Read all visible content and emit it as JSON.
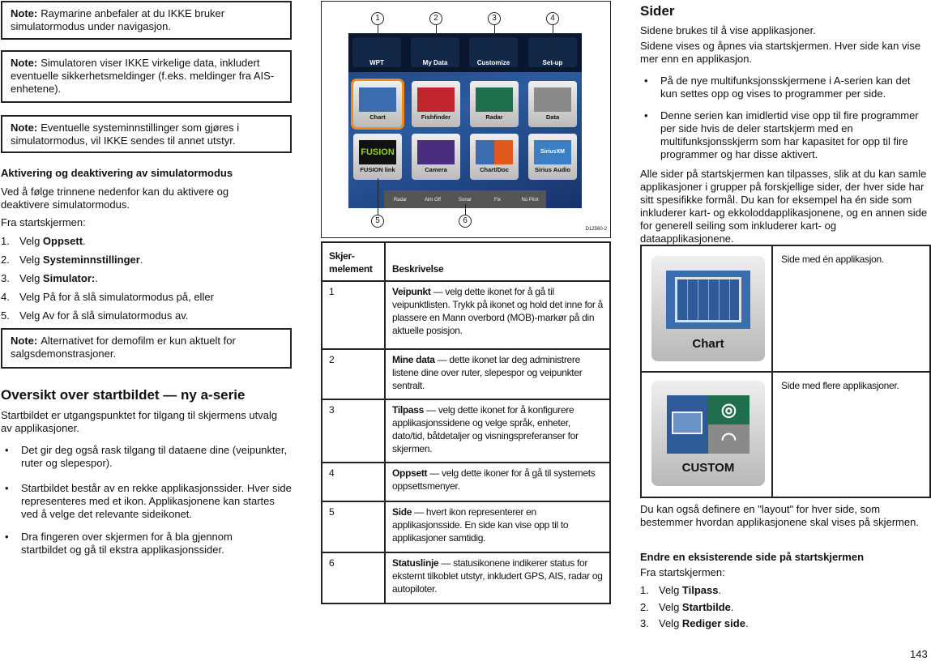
{
  "left": {
    "notes": [
      {
        "label": "Note:",
        "text": "Raymarine anbefaler at du IKKE bruker simulatormodus under navigasjon."
      },
      {
        "label": "Note:",
        "text": "Simulatoren viser IKKE virkelige data, inkludert eventuelle sikkerhetsmeldinger (f.eks. meldinger fra AIS-enhetene)."
      },
      {
        "label": "Note:",
        "text": "Eventuelle systeminnstillinger som gjøres i simulatormodus, vil IKKE sendes til annet utstyr."
      },
      {
        "label": "Note:",
        "text": "Alternativet for demofilm er kun aktuelt for salgsdemonstrasjoner."
      }
    ],
    "heading1": "Aktivering og deaktivering av simulatormodus",
    "para1": "Ved å følge trinnene nedenfor kan du aktivere og deaktivere simulatormodus.",
    "from_home": "Fra startskjermen:",
    "steps": [
      {
        "n": "1.",
        "pre": "Velg ",
        "bold": "Oppsett",
        "post": "."
      },
      {
        "n": "2.",
        "pre": "Velg ",
        "bold": "Systeminnstillinger",
        "post": "."
      },
      {
        "n": "3.",
        "pre": "Velg ",
        "bold": "Simulator:",
        "post": "."
      },
      {
        "n": "4.",
        "pre": "Velg På for å slå simulatormodus på, eller",
        "bold": "",
        "post": ""
      },
      {
        "n": "5.",
        "pre": "Velg Av for å slå simulatormodus av.",
        "bold": "",
        "post": ""
      }
    ],
    "heading2": "Oversikt over startbildet — ny a-serie",
    "para2": "Startbildet er utgangspunktet for tilgang til skjermens utvalg av applikasjoner.",
    "bullets": [
      "Det gir deg også rask tilgang til dataene dine (veipunkter, ruter og slepespor).",
      "Startbildet består av en rekke applikasjonssider. Hver side representeres med et ikon. Applikasjonene kan startes ved å velge det relevante sideikonet.",
      "Dra fingeren over skjermen for å bla gjennom startbildet og gå til ekstra applikasjonssider."
    ]
  },
  "figure": {
    "callouts": [
      "1",
      "2",
      "3",
      "4",
      "5",
      "6"
    ],
    "top_buttons": [
      "WPT",
      "My Data",
      "Customize",
      "Set-up"
    ],
    "tiles": [
      "Chart",
      "Fishfinder",
      "Radar",
      "Data",
      "FUSION link",
      "Camera",
      "Chart/Doc",
      "Sirius Audio"
    ],
    "fusion_logo": "FUSION",
    "sirius_logo": "SiriusXM",
    "status": [
      "Radar",
      "Alm Off",
      "Sonar",
      "Fix",
      "No Pilot"
    ],
    "code": "D12560-2"
  },
  "table": {
    "headers": [
      "Skjer-melement",
      "Beskrivelse"
    ],
    "rows": [
      {
        "id": "1",
        "term": "Veipunkt",
        "desc": " — velg dette ikonet for å gå til veipunktlisten. Trykk på ikonet og hold det inne for å plassere en Mann overbord (MOB)-markør på din aktuelle posisjon."
      },
      {
        "id": "2",
        "term": "Mine data",
        "desc": " — dette ikonet lar deg administrere listene dine over ruter, slepespor og veipunkter sentralt."
      },
      {
        "id": "3",
        "term": "Tilpass",
        "desc": " — velg dette ikonet for å konfigurere applikasjonssidene og velge språk, enheter, dato/tid, båtdetaljer og visningspreferanser for skjermen."
      },
      {
        "id": "4",
        "term": "Oppsett",
        "desc": " — velg dette ikoner for å gå til systemets oppsettsmenyer."
      },
      {
        "id": "5",
        "term": "Side",
        "desc": " — hvert ikon representerer en applikasjonsside. En side kan vise opp til to applikasjoner samtidig."
      },
      {
        "id": "6",
        "term": "Statuslinje",
        "desc": " — statusikonene indikerer status for eksternt tilkoblet utstyr, inkludert GPS, AIS, radar og autopiloter."
      }
    ]
  },
  "right": {
    "heading": "Sider",
    "p1": "Sidene brukes til å vise applikasjoner.",
    "p2": "Sidene vises og åpnes via startskjermen. Hver side kan vise mer enn en applikasjon.",
    "bullets": [
      "På de nye multifunksjonsskjermene i A-serien kan det kun settes opp og vises to programmer per side.",
      "Denne serien kan imidlertid vise opp til fire programmer per side hvis de deler startskjerm med en multifunksjonsskjerm som har kapasitet for opp til fire programmer og har disse aktivert."
    ],
    "p3": "Alle sider på startskjermen kan tilpasses, slik at du kan samle applikasjoner i grupper på forskjellige sider, der hver side har sitt spesifikke formål. Du kan for eksempel ha én side som inkluderer kart- og ekkoloddapplikasjonene, og en annen side for generell seiling som inkluderer kart- og dataapplikasjonene.",
    "examples": [
      {
        "tile": "Chart",
        "desc": "Side med én applikasjon."
      },
      {
        "tile": "CUSTOM",
        "desc": "Side med flere applikasjoner."
      }
    ],
    "p4": "Du kan også definere en \"layout\" for hver side, som bestemmer hvordan applikasjonene skal vises på skjermen.",
    "heading2": "Endre en eksisterende side på startskjermen",
    "from_home": "Fra startskjermen:",
    "steps": [
      {
        "n": "1.",
        "pre": "Velg ",
        "bold": "Tilpass",
        "post": "."
      },
      {
        "n": "2.",
        "pre": "Velg ",
        "bold": "Startbilde",
        "post": "."
      },
      {
        "n": "3.",
        "pre": "Velg ",
        "bold": "Rediger side",
        "post": "."
      }
    ]
  },
  "page_number": "143"
}
